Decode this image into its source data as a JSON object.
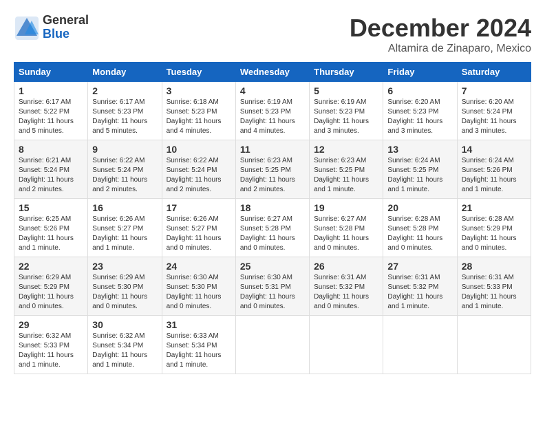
{
  "header": {
    "logo_general": "General",
    "logo_blue": "Blue",
    "month_title": "December 2024",
    "subtitle": "Altamira de Zinaparo, Mexico"
  },
  "calendar": {
    "days_of_week": [
      "Sunday",
      "Monday",
      "Tuesday",
      "Wednesday",
      "Thursday",
      "Friday",
      "Saturday"
    ],
    "weeks": [
      [
        null,
        {
          "day": "2",
          "sunrise": "Sunrise: 6:17 AM",
          "sunset": "Sunset: 5:23 PM",
          "daylight": "Daylight: 11 hours and 5 minutes."
        },
        {
          "day": "3",
          "sunrise": "Sunrise: 6:18 AM",
          "sunset": "Sunset: 5:23 PM",
          "daylight": "Daylight: 11 hours and 4 minutes."
        },
        {
          "day": "4",
          "sunrise": "Sunrise: 6:19 AM",
          "sunset": "Sunset: 5:23 PM",
          "daylight": "Daylight: 11 hours and 4 minutes."
        },
        {
          "day": "5",
          "sunrise": "Sunrise: 6:19 AM",
          "sunset": "Sunset: 5:23 PM",
          "daylight": "Daylight: 11 hours and 3 minutes."
        },
        {
          "day": "6",
          "sunrise": "Sunrise: 6:20 AM",
          "sunset": "Sunset: 5:23 PM",
          "daylight": "Daylight: 11 hours and 3 minutes."
        },
        {
          "day": "7",
          "sunrise": "Sunrise: 6:20 AM",
          "sunset": "Sunset: 5:24 PM",
          "daylight": "Daylight: 11 hours and 3 minutes."
        }
      ],
      [
        {
          "day": "1",
          "sunrise": "Sunrise: 6:17 AM",
          "sunset": "Sunset: 5:22 PM",
          "daylight": "Daylight: 11 hours and 5 minutes."
        },
        null,
        null,
        null,
        null,
        null,
        null
      ],
      [
        {
          "day": "8",
          "sunrise": "Sunrise: 6:21 AM",
          "sunset": "Sunset: 5:24 PM",
          "daylight": "Daylight: 11 hours and 2 minutes."
        },
        {
          "day": "9",
          "sunrise": "Sunrise: 6:22 AM",
          "sunset": "Sunset: 5:24 PM",
          "daylight": "Daylight: 11 hours and 2 minutes."
        },
        {
          "day": "10",
          "sunrise": "Sunrise: 6:22 AM",
          "sunset": "Sunset: 5:24 PM",
          "daylight": "Daylight: 11 hours and 2 minutes."
        },
        {
          "day": "11",
          "sunrise": "Sunrise: 6:23 AM",
          "sunset": "Sunset: 5:25 PM",
          "daylight": "Daylight: 11 hours and 2 minutes."
        },
        {
          "day": "12",
          "sunrise": "Sunrise: 6:23 AM",
          "sunset": "Sunset: 5:25 PM",
          "daylight": "Daylight: 11 hours and 1 minute."
        },
        {
          "day": "13",
          "sunrise": "Sunrise: 6:24 AM",
          "sunset": "Sunset: 5:25 PM",
          "daylight": "Daylight: 11 hours and 1 minute."
        },
        {
          "day": "14",
          "sunrise": "Sunrise: 6:24 AM",
          "sunset": "Sunset: 5:26 PM",
          "daylight": "Daylight: 11 hours and 1 minute."
        }
      ],
      [
        {
          "day": "15",
          "sunrise": "Sunrise: 6:25 AM",
          "sunset": "Sunset: 5:26 PM",
          "daylight": "Daylight: 11 hours and 1 minute."
        },
        {
          "day": "16",
          "sunrise": "Sunrise: 6:26 AM",
          "sunset": "Sunset: 5:27 PM",
          "daylight": "Daylight: 11 hours and 1 minute."
        },
        {
          "day": "17",
          "sunrise": "Sunrise: 6:26 AM",
          "sunset": "Sunset: 5:27 PM",
          "daylight": "Daylight: 11 hours and 0 minutes."
        },
        {
          "day": "18",
          "sunrise": "Sunrise: 6:27 AM",
          "sunset": "Sunset: 5:28 PM",
          "daylight": "Daylight: 11 hours and 0 minutes."
        },
        {
          "day": "19",
          "sunrise": "Sunrise: 6:27 AM",
          "sunset": "Sunset: 5:28 PM",
          "daylight": "Daylight: 11 hours and 0 minutes."
        },
        {
          "day": "20",
          "sunrise": "Sunrise: 6:28 AM",
          "sunset": "Sunset: 5:28 PM",
          "daylight": "Daylight: 11 hours and 0 minutes."
        },
        {
          "day": "21",
          "sunrise": "Sunrise: 6:28 AM",
          "sunset": "Sunset: 5:29 PM",
          "daylight": "Daylight: 11 hours and 0 minutes."
        }
      ],
      [
        {
          "day": "22",
          "sunrise": "Sunrise: 6:29 AM",
          "sunset": "Sunset: 5:29 PM",
          "daylight": "Daylight: 11 hours and 0 minutes."
        },
        {
          "day": "23",
          "sunrise": "Sunrise: 6:29 AM",
          "sunset": "Sunset: 5:30 PM",
          "daylight": "Daylight: 11 hours and 0 minutes."
        },
        {
          "day": "24",
          "sunrise": "Sunrise: 6:30 AM",
          "sunset": "Sunset: 5:30 PM",
          "daylight": "Daylight: 11 hours and 0 minutes."
        },
        {
          "day": "25",
          "sunrise": "Sunrise: 6:30 AM",
          "sunset": "Sunset: 5:31 PM",
          "daylight": "Daylight: 11 hours and 0 minutes."
        },
        {
          "day": "26",
          "sunrise": "Sunrise: 6:31 AM",
          "sunset": "Sunset: 5:32 PM",
          "daylight": "Daylight: 11 hours and 0 minutes."
        },
        {
          "day": "27",
          "sunrise": "Sunrise: 6:31 AM",
          "sunset": "Sunset: 5:32 PM",
          "daylight": "Daylight: 11 hours and 1 minute."
        },
        {
          "day": "28",
          "sunrise": "Sunrise: 6:31 AM",
          "sunset": "Sunset: 5:33 PM",
          "daylight": "Daylight: 11 hours and 1 minute."
        }
      ],
      [
        {
          "day": "29",
          "sunrise": "Sunrise: 6:32 AM",
          "sunset": "Sunset: 5:33 PM",
          "daylight": "Daylight: 11 hours and 1 minute."
        },
        {
          "day": "30",
          "sunrise": "Sunrise: 6:32 AM",
          "sunset": "Sunset: 5:34 PM",
          "daylight": "Daylight: 11 hours and 1 minute."
        },
        {
          "day": "31",
          "sunrise": "Sunrise: 6:33 AM",
          "sunset": "Sunset: 5:34 PM",
          "daylight": "Daylight: 11 hours and 1 minute."
        },
        null,
        null,
        null,
        null
      ]
    ]
  }
}
